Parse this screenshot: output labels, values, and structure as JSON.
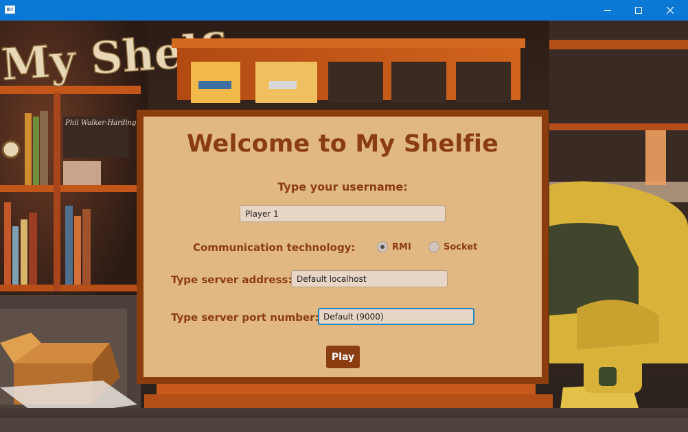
{
  "window": {
    "title": ""
  },
  "background": {
    "logo_text": "My Shelfie",
    "credit": "Phil Walker-Harding & Matthew Dunstan"
  },
  "dialog": {
    "title": "Welcome to My Shelfie",
    "username_label": "Type your username:",
    "username_value": "Player 1",
    "comm_label": "Communication technology:",
    "comm_options": [
      {
        "label": "RMI",
        "selected": true
      },
      {
        "label": "Socket",
        "selected": false
      }
    ],
    "address_label": "Type server address:",
    "address_value": "Default localhost",
    "port_label": "Type server port number:",
    "port_value": "Default (9000)",
    "play_label": "Play"
  },
  "colors": {
    "titlebar": "#0a78d4",
    "dialog_bg": "#e1b882",
    "dialog_frame": "#8b3d0e",
    "text": "#8b3d12",
    "focus": "#1f87c6"
  }
}
